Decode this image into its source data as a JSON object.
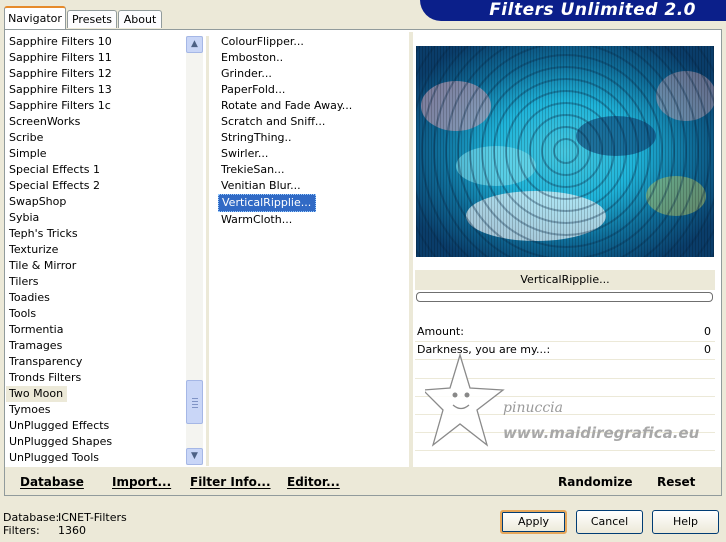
{
  "tabs": [
    "Navigator",
    "Presets",
    "About"
  ],
  "banner_title": "Filters Unlimited 2.0",
  "categories": [
    "Sapphire Filters 10",
    "Sapphire Filters 11",
    "Sapphire Filters 12",
    "Sapphire Filters 13",
    "Sapphire Filters 1c",
    "ScreenWorks",
    "Scribe",
    "Simple",
    "Special Effects 1",
    "Special Effects 2",
    "SwapShop",
    "Sybia",
    "Teph's Tricks",
    "Texturize",
    "Tile & Mirror",
    "Tilers",
    "Toadies",
    "Tools",
    "Tormentia",
    "Tramages",
    "Transparency",
    "Tronds Filters",
    "Two Moon",
    "Tymoes",
    "UnPlugged Effects",
    "UnPlugged Shapes",
    "UnPlugged Tools"
  ],
  "selected_category": "Two Moon",
  "filters": [
    "ColourFlipper...",
    "Emboston..",
    "Grinder...",
    "PaperFold...",
    "Rotate and Fade Away...",
    "Scratch and Sniff...",
    "StringThing..",
    "Swirler...",
    "TrekieSan...",
    "Venitian Blur...",
    "VerticalRipplie...",
    "WarmCloth..."
  ],
  "selected_filter": "VerticalRipplie...",
  "preview_filter_name": "VerticalRipplie...",
  "progress": 0,
  "params": [
    {
      "label": "Amount:",
      "value": "0"
    },
    {
      "label": "Darkness, you are my...:",
      "value": "0"
    }
  ],
  "watermark": {
    "name": "pinuccia",
    "url": "www.maidiregrafica.eu"
  },
  "bottom_buttons": {
    "database": "Database",
    "import": "Import...",
    "filter_info": "Filter Info...",
    "editor": "Editor...",
    "randomize": "Randomize",
    "reset": "Reset"
  },
  "status": {
    "database_label": "Database:",
    "database_value": "ICNET-Filters",
    "filters_label": "Filters:",
    "filters_value": "1360"
  },
  "dialog_buttons": {
    "apply": "Apply",
    "cancel": "Cancel",
    "help": "Help"
  },
  "colors": {
    "accent": "#316ac5",
    "banner": "#0b1f8a",
    "face": "#ece9d8",
    "tab_highlight": "#e68b2c"
  },
  "icons": [
    "scroll-up-icon",
    "scroll-down-icon",
    "star-mascot-icon"
  ]
}
